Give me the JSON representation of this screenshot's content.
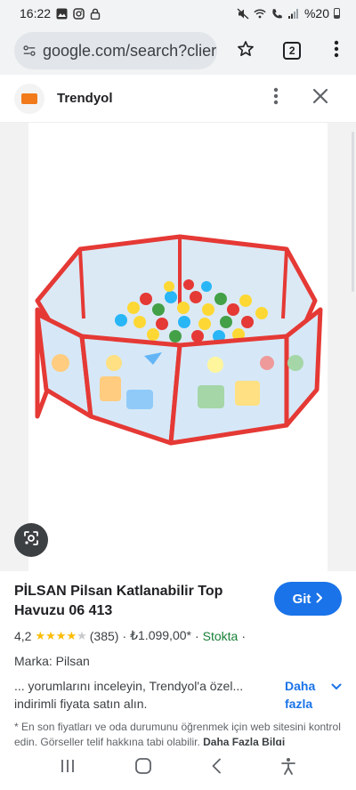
{
  "status_bar": {
    "time": "16:22",
    "battery": "%20",
    "left_icons": [
      "gallery-icon",
      "instagram-icon",
      "lock-icon"
    ],
    "right_icons": [
      "mute-icon",
      "wifi-icon",
      "call-icon",
      "signal-icon",
      "battery-icon"
    ]
  },
  "browser": {
    "url": "google.com/search?clier",
    "tab_count": "2"
  },
  "source": {
    "name": "Trendyol"
  },
  "product": {
    "title": "PİLSAN Pilsan Katlanabilir Top Havuzu 06 413",
    "go_label": "Git",
    "rating": "4,2",
    "rating_value": 4.2,
    "review_count": "(385)",
    "price": "₺1.099,00*",
    "stock": "Stokta",
    "brand": "Marka: Pilsan",
    "description": "... yorumlarını inceleyin, Trendyol'a özel... indirimli fiyata satın alın.",
    "more_label": "Daha fazla",
    "disclaimer": "* En son fiyatları ve oda durumunu öğrenmek için web sitesini kontrol edin. Görseller telif hakkına tabi olabilir.",
    "disclaimer_link": "Daha Fazla Bilgi"
  },
  "colors": {
    "accent": "#1a73e8",
    "brand_orange": "#f27a1a",
    "stock_green": "#188038",
    "star": "#fbbc04"
  }
}
